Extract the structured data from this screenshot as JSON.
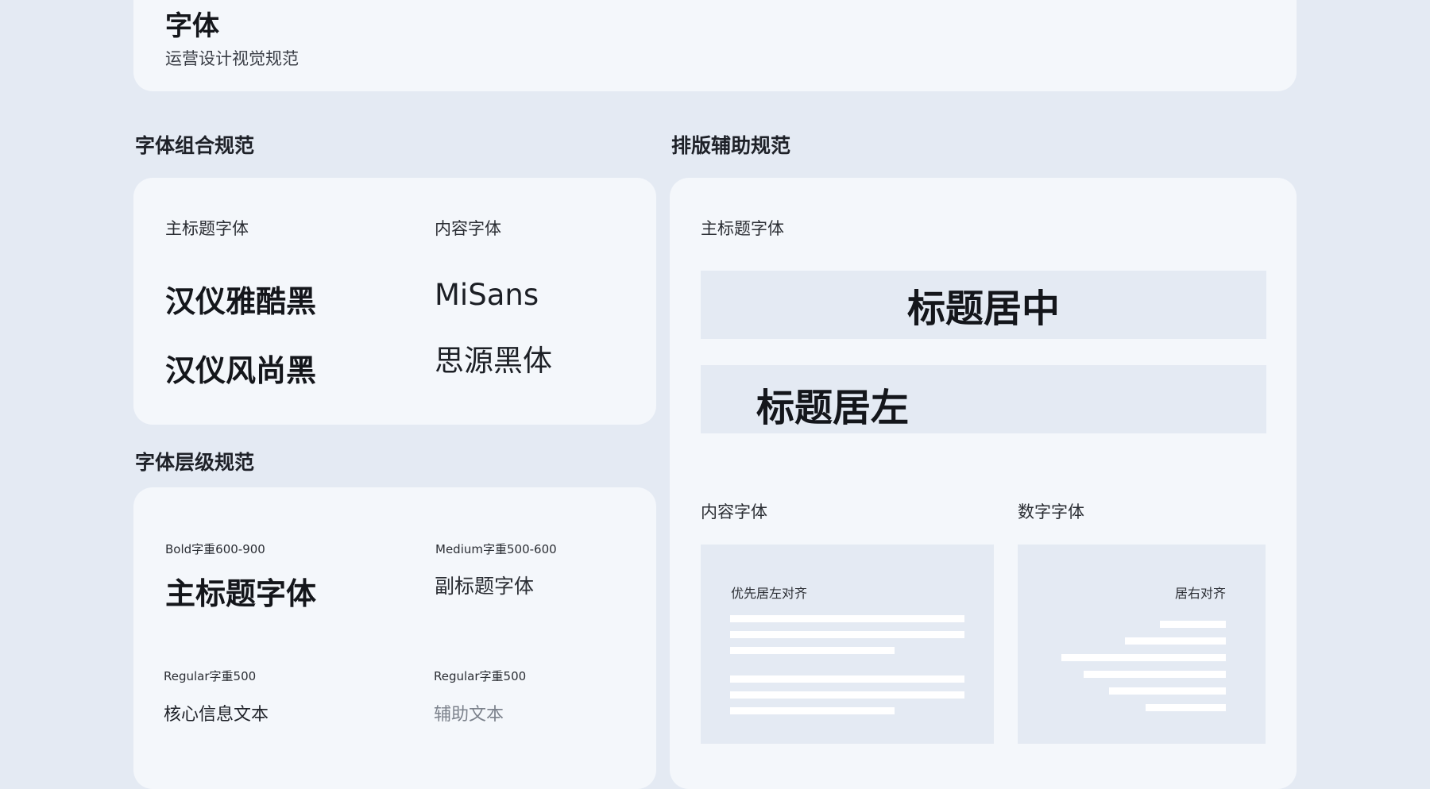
{
  "header": {
    "title": "字体",
    "subtitle": "运营设计视觉规范"
  },
  "combo": {
    "section_title": "字体组合规范",
    "title_col_label": "主标题字体",
    "content_col_label": "内容字体",
    "title_fonts": [
      "汉仪雅酷黑",
      "汉仪风尚黑"
    ],
    "content_fonts": [
      "MiSans",
      "思源黑体"
    ]
  },
  "levels": {
    "section_title": "字体层级规范",
    "items": [
      {
        "weight": "Bold字重600-900",
        "sample": "主标题字体"
      },
      {
        "weight": "Medium字重500-600",
        "sample": "副标题字体"
      },
      {
        "weight": "Regular字重500",
        "sample": "核心信息文本"
      },
      {
        "weight": "Regular字重500",
        "sample": "辅助文本"
      }
    ]
  },
  "layout_guide": {
    "section_title": "排版辅助规范",
    "title_label": "主标题字体",
    "title_center": "标题居中",
    "title_left": "标题居左",
    "content_label": "内容字体",
    "content_note": "优先居左对齐",
    "number_label": "数字字体",
    "number_note": "居右对齐"
  },
  "colors": {
    "page_bg": "#e4eaf3",
    "card_bg": "#f4f7fb",
    "muted_text": "#7c828c"
  }
}
